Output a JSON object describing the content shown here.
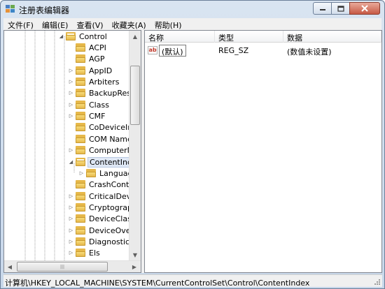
{
  "window": {
    "title": "注册表编辑器"
  },
  "menu": [
    {
      "label": "文件(F)"
    },
    {
      "label": "编辑(E)"
    },
    {
      "label": "查看(V)"
    },
    {
      "label": "收藏夹(A)"
    },
    {
      "label": "帮助(H)"
    }
  ],
  "tree": {
    "items": [
      {
        "label": "Control",
        "expander": "expanded"
      },
      {
        "label": "ACPI",
        "expander": "none"
      },
      {
        "label": "AGP",
        "expander": "none"
      },
      {
        "label": "AppID",
        "expander": "collapsed"
      },
      {
        "label": "Arbiters",
        "expander": "collapsed"
      },
      {
        "label": "BackupRestor",
        "expander": "collapsed"
      },
      {
        "label": "Class",
        "expander": "collapsed"
      },
      {
        "label": "CMF",
        "expander": "collapsed"
      },
      {
        "label": "CoDeviceInsta",
        "expander": "none"
      },
      {
        "label": "COM Name A",
        "expander": "none"
      },
      {
        "label": "ComputerNar",
        "expander": "collapsed"
      },
      {
        "label": "ContentIndex",
        "expander": "expanded",
        "selected": true
      },
      {
        "label": "Language",
        "expander": "collapsed"
      },
      {
        "label": "CrashControl",
        "expander": "none"
      },
      {
        "label": "CriticalDevice",
        "expander": "collapsed"
      },
      {
        "label": "Cryptography",
        "expander": "collapsed"
      },
      {
        "label": "DeviceClasses",
        "expander": "collapsed"
      },
      {
        "label": "DeviceOverric",
        "expander": "collapsed"
      },
      {
        "label": "Diagnostics",
        "expander": "collapsed"
      },
      {
        "label": "Els",
        "expander": "collapsed"
      }
    ]
  },
  "list": {
    "columns": [
      "名称",
      "类型",
      "数据"
    ],
    "rows": [
      {
        "name": "(默认)",
        "type": "REG_SZ",
        "data": "(数值未设置)",
        "icon": "ab"
      }
    ]
  },
  "status": {
    "path": "计算机\\HKEY_LOCAL_MACHINE\\SYSTEM\\CurrentControlSet\\Control\\ContentIndex"
  },
  "colors": {
    "folder": "#e6b84a",
    "selection": "#dfe8f5",
    "frame": "#c7d7ea"
  }
}
